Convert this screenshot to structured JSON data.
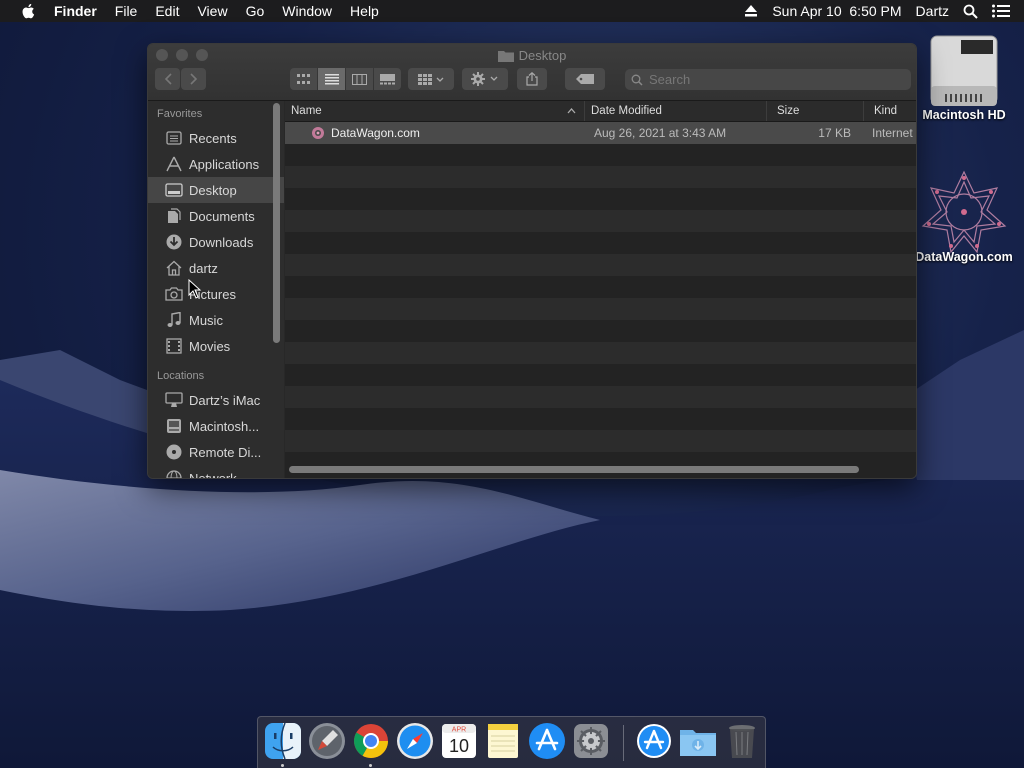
{
  "menubar": {
    "app_name": "Finder",
    "menus": [
      "File",
      "Edit",
      "View",
      "Go",
      "Window",
      "Help"
    ],
    "clock": "Sun Apr 10  6:50 PM",
    "user": "Dartz"
  },
  "desktop": {
    "icons": [
      {
        "label": "Macintosh HD",
        "icon": "hard-drive-icon"
      },
      {
        "label": "DataWagon.com",
        "icon": "internet-location-icon"
      }
    ]
  },
  "window": {
    "title": "Desktop",
    "search_placeholder": "Search",
    "sidebar": {
      "favorites_label": "Favorites",
      "favorites": [
        {
          "label": "Recents",
          "icon": "recents-icon"
        },
        {
          "label": "Applications",
          "icon": "applications-icon"
        },
        {
          "label": "Desktop",
          "icon": "desktop-icon",
          "selected": true
        },
        {
          "label": "Documents",
          "icon": "documents-icon"
        },
        {
          "label": "Downloads",
          "icon": "downloads-icon"
        },
        {
          "label": "dartz",
          "icon": "home-icon"
        },
        {
          "label": "Pictures",
          "icon": "camera-icon"
        },
        {
          "label": "Music",
          "icon": "music-icon"
        },
        {
          "label": "Movies",
          "icon": "movies-icon"
        }
      ],
      "locations_label": "Locations",
      "locations": [
        {
          "label": "Dartz’s iMac",
          "icon": "computer-icon"
        },
        {
          "label": "Macintosh...",
          "icon": "disk-icon"
        },
        {
          "label": "Remote Di...",
          "icon": "optical-disc-icon"
        },
        {
          "label": "Network",
          "icon": "network-icon"
        }
      ]
    },
    "columns": {
      "name": "Name",
      "date_modified": "Date Modified",
      "size": "Size",
      "kind": "Kind"
    },
    "files": [
      {
        "name": "DataWagon.com",
        "date_modified": "Aug 26, 2021 at 3:43 AM",
        "size": "17 KB",
        "kind": "Internet"
      }
    ]
  },
  "dock": {
    "apps": [
      {
        "name": "Finder",
        "icon": "finder-icon",
        "running": true
      },
      {
        "name": "Launchpad",
        "icon": "launchpad-icon",
        "running": false
      },
      {
        "name": "Google Chrome",
        "icon": "chrome-icon",
        "running": true
      },
      {
        "name": "Safari",
        "icon": "safari-icon",
        "running": false
      },
      {
        "name": "Calendar",
        "icon": "calendar-icon",
        "running": false,
        "month": "APR",
        "day": "10"
      },
      {
        "name": "Notes",
        "icon": "notes-icon",
        "running": false
      },
      {
        "name": "App Store",
        "icon": "app-store-icon",
        "running": false
      },
      {
        "name": "System Preferences",
        "icon": "system-preferences-icon",
        "running": false
      },
      {
        "name": "Applications",
        "icon": "app-store-folder-icon",
        "running": false
      },
      {
        "name": "Downloads",
        "icon": "downloads-folder-icon",
        "running": false
      },
      {
        "name": "Trash",
        "icon": "trash-icon",
        "running": false
      }
    ]
  }
}
